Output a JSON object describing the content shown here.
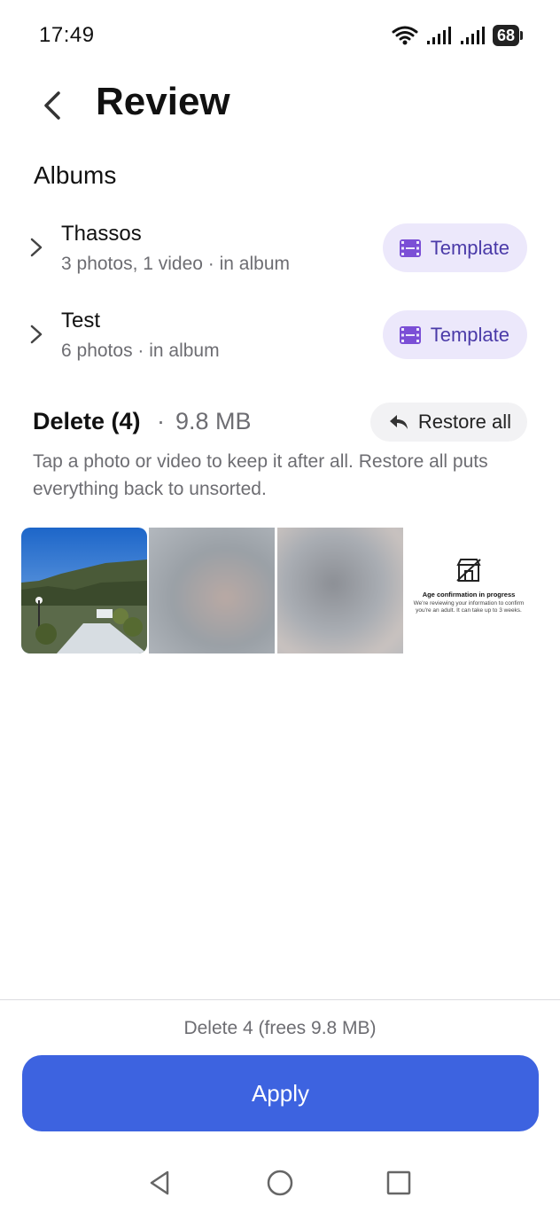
{
  "status_bar": {
    "time": "17:49",
    "battery": "68",
    "wifi_icon": "wifi-icon",
    "signal_icon": "cell-signal-icon"
  },
  "header": {
    "title": "Review",
    "back_icon": "back-arrow-icon"
  },
  "albums": {
    "title": "Albums",
    "items": [
      {
        "name": "Thassos",
        "meta": "3 photos, 1 video · in album",
        "button_label": "Template",
        "icon": "film-icon"
      },
      {
        "name": "Test",
        "meta": "6 photos · in album",
        "button_label": "Template",
        "icon": "film-icon"
      }
    ]
  },
  "delete_section": {
    "title": "Delete (4)",
    "separator": "·",
    "size": "9.8 MB",
    "restore_label": "Restore all",
    "restore_icon": "undo-icon",
    "hint": "Tap a photo or video to keep it after all. Restore all puts everything back to unsorted.",
    "thumbnails": [
      {
        "kind": "photo",
        "description": "landscape photo"
      },
      {
        "kind": "photo",
        "description": "blurred photo"
      },
      {
        "kind": "photo",
        "description": "blurred photo"
      },
      {
        "kind": "screenshot",
        "title": "Age confirmation in progress",
        "text": "We're reviewing your information to confirm you're an adult. It can take up to 3 weeks."
      }
    ]
  },
  "footer": {
    "summary": "Delete 4 (frees 9.8 MB)",
    "apply_label": "Apply"
  },
  "colors": {
    "accent": "#3d63e0",
    "template_bg": "#ece8fb",
    "template_fg": "#4a3aa8",
    "film_icon": "#7b4fd6"
  }
}
